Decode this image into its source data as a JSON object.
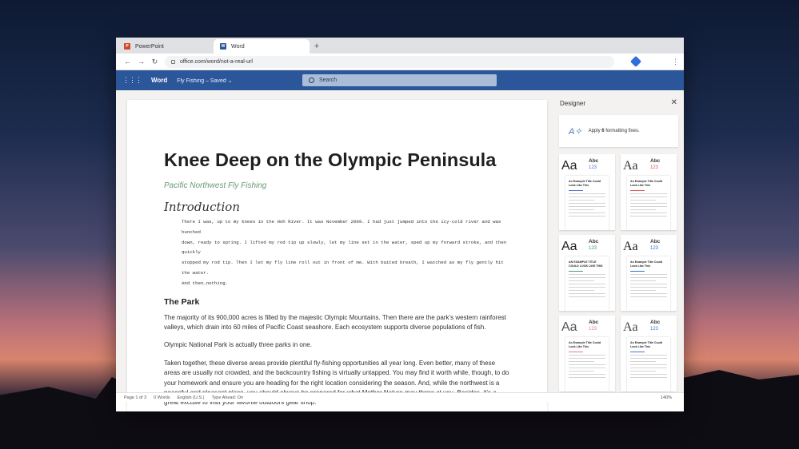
{
  "browser": {
    "tabs": [
      {
        "label": "PowerPoint",
        "icon": "powerpoint-icon",
        "active": false
      },
      {
        "label": "Word",
        "icon": "word-icon",
        "active": true
      }
    ],
    "url": "office.com/word/not-a-real-url"
  },
  "ribbon": {
    "app_name": "Word",
    "doc_name": "Fly Fishing – Saved ⌄",
    "search_placeholder": "Search",
    "color": "#2b579a"
  },
  "document": {
    "title": "Knee Deep on the Olympic Peninsula",
    "subtitle": "Pacific Northwest Fly Fishing",
    "intro_heading": "Introduction",
    "intro_lines": [
      "There I was, up to my knees in the Hoh River. It was November 2009. I had just jumped into the icy-cold river and was hunched",
      "down, ready to spring. I lifted my rod tip up slowly, let my line set in the water, sped up my forward stroke, and then quickly",
      "stopped my rod tip. Then I let my fly line roll out in front of me. With baited breath, I watched as my fly gently hit the water.",
      "And then…nothing."
    ],
    "section_heading": "The Park",
    "paragraphs": [
      "The majority of its 900,000 acres is filled by the majestic Olympic Mountains. Then there are the park’s western rainforest valleys, which drain into 60 miles of Pacific Coast seashore. Each ecosystem supports diverse populations of fish.",
      "Olympic National Park is actually three parks in one.",
      "Taken together, these diverse areas provide plentiful fly-fishing opportunities all year long. Even better, many of these areas are usually not crowded, and the backcountry fishing is virtually untapped. You may find it worth while, though, to do your homework and ensure you are heading for the right location considering the season. And, while the northwest is a peaceful and pleasant place, you should always be prepared for what Mother Nature may throw at you. Besides, it’s a great excuse to visit your favorite outdoors gear shop."
    ],
    "subtitle_color": "#6a9a72"
  },
  "designer": {
    "title": "Designer",
    "fix_prefix": "Apply ",
    "fix_count": "6",
    "fix_suffix": " formatting fixes.",
    "cards": [
      {
        "aa": "Aa",
        "abc": "Abc",
        "num": "123",
        "sheet_title": "An Example Title Could Look Like This",
        "aa_color": "#1f1f1f",
        "num_color": "#5b6fd6"
      },
      {
        "aa": "Aa",
        "abc": "Abc",
        "num": "123",
        "sheet_title": "An Example Title Could Look Like This",
        "aa_color": "#333333",
        "num_color": "#e05a5a"
      },
      {
        "aa": "Aa",
        "abc": "Abc",
        "num": "123",
        "sheet_title": "AN EXAMPLE TITLE COULD LOOK LIKE THIS",
        "aa_color": "#222222",
        "num_color": "#3aa36b"
      },
      {
        "aa": "Aa",
        "abc": "Abc",
        "num": "123",
        "sheet_title": "An Example Title Could Look Like This",
        "aa_color": "#1f1f1f",
        "num_color": "#2f6fdb"
      },
      {
        "aa": "Aa",
        "abc": "Abc",
        "num": "123",
        "sheet_title": "An Example Title Could Look Like This",
        "aa_color": "#555555",
        "num_color": "#e07aa0"
      },
      {
        "aa": "Aa",
        "abc": "Abc",
        "num": "123",
        "sheet_title": "An Example Title Could Look Like This",
        "aa_color": "#444444",
        "num_color": "#3a7bd5"
      }
    ]
  },
  "status": {
    "page": "Page 1 of 3",
    "words": "0 Words",
    "language": "English (U.S.)",
    "type_ahead": "Type Ahead: On",
    "zoom": "140%"
  }
}
